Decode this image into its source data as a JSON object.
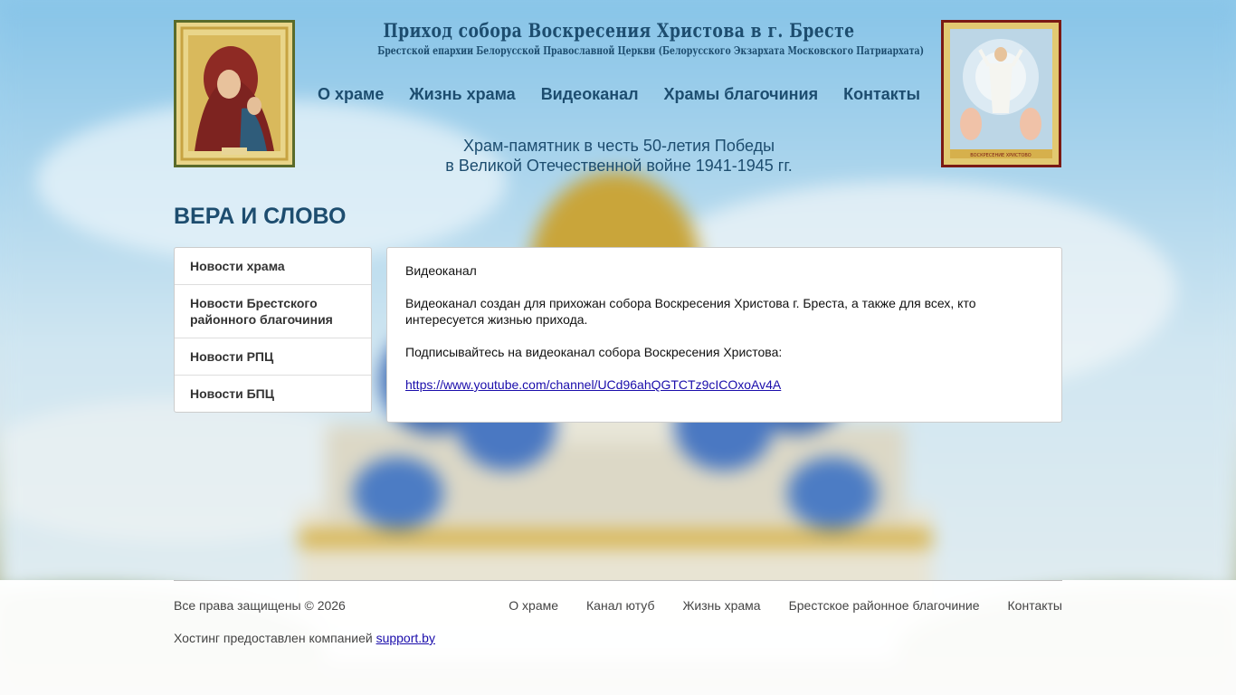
{
  "header": {
    "title": "Приход собора Воскресения Христова в г. Бресте",
    "subtitle": "Брестской епархии Белорусской Православной Церкви (Белорусского Экзархата Московского Патриархата)",
    "tagline_line1": "Храм-памятник в честь 50-летия Победы",
    "tagline_line2": "в Великой Отечественной войне 1941-1945 гг.",
    "icon_left": "theotokos-icon-image",
    "icon_right": "resurrection-icon-image",
    "icon_right_caption": "ВОСКРЕСЕНИЕ ХРИСТОВО"
  },
  "nav": {
    "items": [
      "О храме",
      "Жизнь храма",
      "Видеоканал",
      "Храмы благочиния",
      "Контакты"
    ]
  },
  "section": {
    "title": "ВЕРА И СЛОВО"
  },
  "sidebar": {
    "items": [
      "Новости храма",
      "Новости Брестского районного благочиния",
      "Новости РПЦ",
      "Новости БПЦ"
    ]
  },
  "content": {
    "heading": "Видеоканал",
    "para1": "Видеоканал создан для прихожан собора Воскресения Христова г. Бреста, а также для всех, кто интересуется жизнью прихода.",
    "para2": "Подписывайтесь на видеоканал собора Воскресения Христова:",
    "link": "https://www.youtube.com/channel/UCd96ahQGTCTz9cICOxoAv4A"
  },
  "footer": {
    "copyright": "Все права защищены © 2026",
    "hosting_prefix": "Хостинг предоставлен компанией ",
    "hosting_link": "support.by",
    "nav": [
      "О храме",
      "Канал ютуб",
      "Жизнь храма",
      "Брестское районное благочиние",
      "Контакты"
    ]
  },
  "colors": {
    "primary": "#1d4d6f",
    "link": "#1a0dab"
  }
}
